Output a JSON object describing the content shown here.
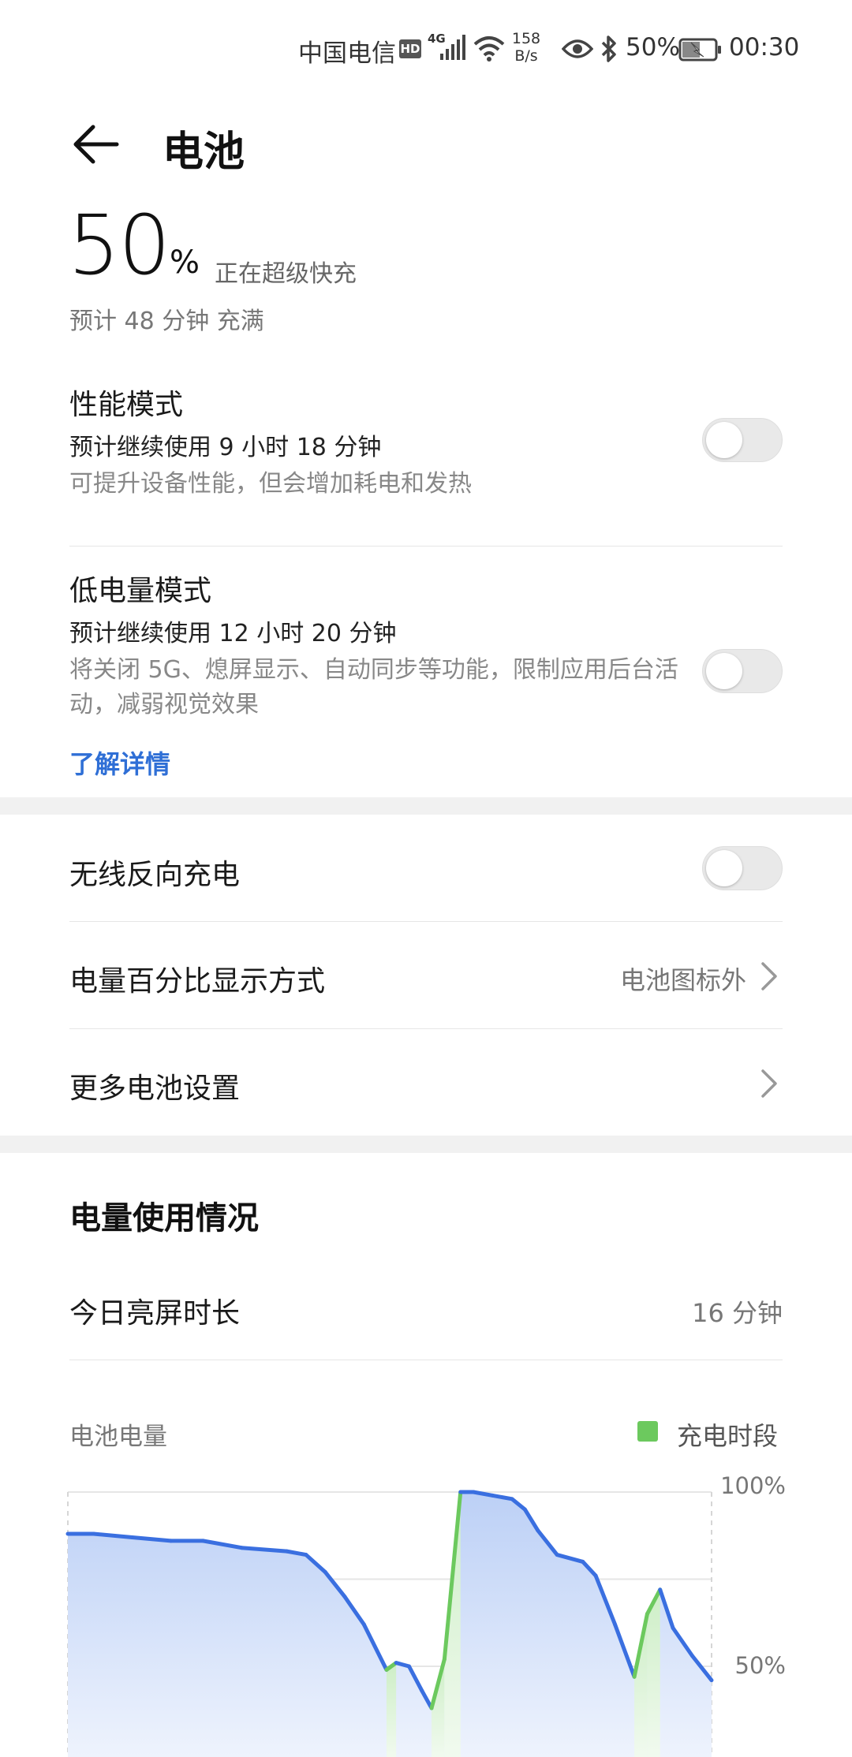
{
  "status_bar": {
    "carrier": "中国电信",
    "hd_badge": "HD",
    "network": "4G",
    "speed_value": "158",
    "speed_unit": "B/s",
    "battery_percent": "50%",
    "time": "00:30",
    "icons": [
      "signal-icon",
      "wifi-icon",
      "eye-icon",
      "bluetooth-icon",
      "battery-charging-icon"
    ]
  },
  "header": {
    "title": "电池"
  },
  "battery": {
    "level": "50",
    "percent_sign": "%",
    "charging_status": "正在超级快充",
    "estimate": "预计 48 分钟 充满"
  },
  "performance_mode": {
    "title": "性能模式",
    "usage": "预计继续使用 9 小时 18 分钟",
    "desc": "可提升设备性能，但会增加耗电和发热",
    "enabled": false
  },
  "low_power_mode": {
    "title": "低电量模式",
    "usage": "预计继续使用 12 小时 20 分钟",
    "desc": "将关闭 5G、熄屏显示、自动同步等功能，限制应用后台活动，减弱视觉效果",
    "link": "了解详情",
    "enabled": false
  },
  "settings": {
    "reverse_charging": {
      "label": "无线反向充电",
      "enabled": false
    },
    "percent_display": {
      "label": "电量百分比显示方式",
      "value": "电池图标外"
    },
    "more_settings": {
      "label": "更多电池设置"
    }
  },
  "usage": {
    "title": "电量使用情况",
    "screen_time_label": "今日亮屏时长",
    "screen_time_value": "16 分钟"
  },
  "colors": {
    "accent_blue": "#2f6fd6",
    "line_blue": "#3a6fe0",
    "charge_green": "#6cc95e"
  },
  "chart_data": {
    "type": "area",
    "title": "电池电量",
    "legend": [
      {
        "name": "充电时段",
        "color": "#6cc95e"
      }
    ],
    "legend_position": "top-right",
    "ylim": [
      0,
      100
    ],
    "yticks": [
      "100%",
      "50%"
    ],
    "grid": true,
    "x": [
      0,
      2,
      4,
      6,
      8,
      10,
      12,
      14,
      16,
      18,
      20,
      22,
      24,
      26,
      28,
      30,
      32,
      34,
      36,
      38,
      40,
      42,
      44,
      46,
      48,
      50,
      52,
      54,
      56,
      58,
      60,
      62,
      64,
      66,
      68,
      70,
      72,
      74,
      76,
      78,
      80,
      82,
      84,
      86,
      88,
      90,
      92,
      94,
      96,
      98,
      100
    ],
    "series": [
      {
        "name": "discharge",
        "values": [
          88,
          88,
          88,
          87,
          87,
          87,
          87,
          86,
          86,
          86,
          86,
          85,
          85,
          84,
          84,
          83,
          82,
          78,
          72,
          66,
          58,
          48,
          50,
          49,
          43,
          38,
          null,
          null,
          null,
          null,
          null,
          null,
          null,
          null,
          null,
          null,
          null,
          null,
          null,
          null,
          null,
          null,
          null,
          null,
          null,
          null,
          null,
          null,
          null,
          null,
          null
        ]
      },
      {
        "name": "charge",
        "values": [
          null,
          null,
          null,
          null,
          null,
          null,
          null,
          null,
          null,
          null,
          null,
          null,
          null,
          null,
          null,
          null,
          null,
          null,
          null,
          null,
          null,
          null,
          null,
          null,
          null,
          null,
          null,
          null,
          null,
          null,
          null,
          null,
          null,
          null,
          null,
          null,
          null,
          null,
          null,
          null,
          null,
          null,
          null,
          null,
          null,
          null,
          null,
          null,
          null,
          null,
          null
        ]
      }
    ],
    "points": [
      {
        "x": 0,
        "y": 88,
        "c": false
      },
      {
        "x": 4,
        "y": 88,
        "c": false
      },
      {
        "x": 10,
        "y": 87,
        "c": false
      },
      {
        "x": 16,
        "y": 86,
        "c": false
      },
      {
        "x": 21,
        "y": 86,
        "c": false
      },
      {
        "x": 27,
        "y": 84,
        "c": false
      },
      {
        "x": 34,
        "y": 83,
        "c": false
      },
      {
        "x": 37,
        "y": 82,
        "c": false
      },
      {
        "x": 40,
        "y": 77,
        "c": false
      },
      {
        "x": 43,
        "y": 70,
        "c": false
      },
      {
        "x": 46,
        "y": 62,
        "c": false
      },
      {
        "x": 49.5,
        "y": 49,
        "c": false
      },
      {
        "x": 51,
        "y": 51,
        "c": true
      },
      {
        "x": 53,
        "y": 50,
        "c": false
      },
      {
        "x": 55,
        "y": 43,
        "c": false
      },
      {
        "x": 56.5,
        "y": 38,
        "c": false
      },
      {
        "x": 58.5,
        "y": 52,
        "c": true
      },
      {
        "x": 61,
        "y": 100,
        "c": true
      },
      {
        "x": 63,
        "y": 100,
        "c": false
      },
      {
        "x": 66,
        "y": 99,
        "c": false
      },
      {
        "x": 69,
        "y": 98,
        "c": false
      },
      {
        "x": 71,
        "y": 95,
        "c": false
      },
      {
        "x": 73,
        "y": 89,
        "c": false
      },
      {
        "x": 76,
        "y": 82,
        "c": false
      },
      {
        "x": 80,
        "y": 80,
        "c": false
      },
      {
        "x": 82,
        "y": 76,
        "c": false
      },
      {
        "x": 85,
        "y": 62,
        "c": false
      },
      {
        "x": 88,
        "y": 47,
        "c": false
      },
      {
        "x": 90,
        "y": 65,
        "c": true
      },
      {
        "x": 92,
        "y": 72,
        "c": true
      },
      {
        "x": 94,
        "y": 61,
        "c": false
      },
      {
        "x": 97,
        "y": 53,
        "c": false
      },
      {
        "x": 100,
        "y": 46,
        "c": false
      }
    ]
  }
}
